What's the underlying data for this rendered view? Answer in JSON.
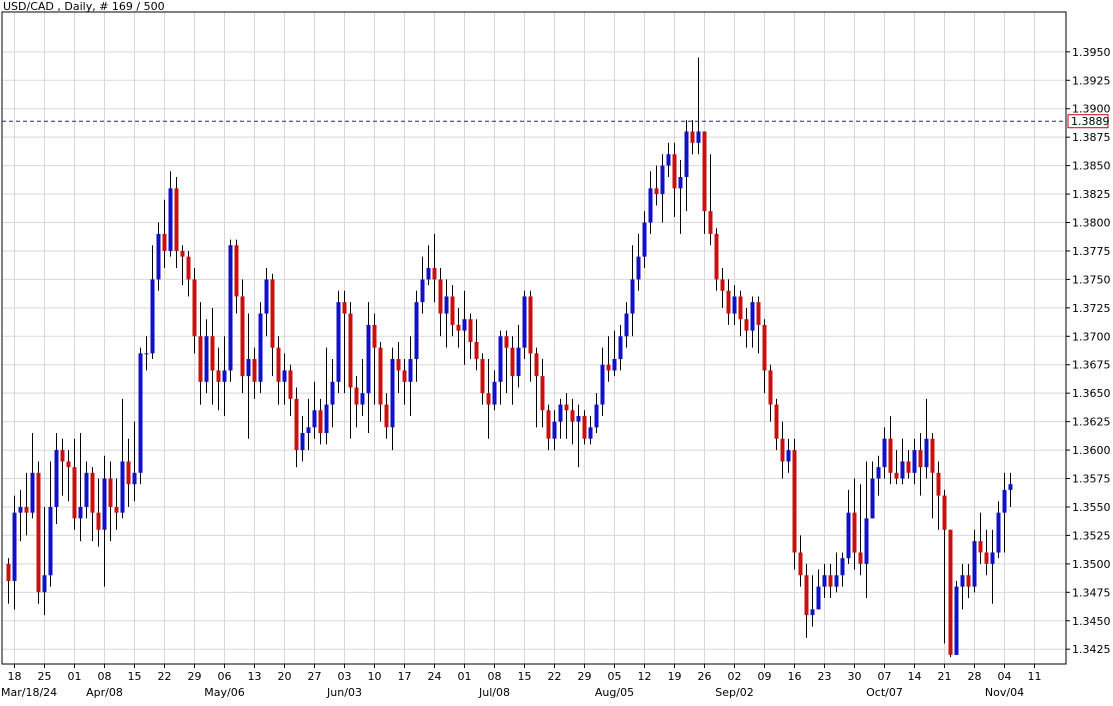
{
  "colors": {
    "up": "#1010c8",
    "down": "#c81010",
    "grid": "#d8d8d8",
    "last_line": "#2020a0",
    "last_box_border": "#d00000",
    "wick": "#000000"
  },
  "chart_data": {
    "type": "candlestick",
    "title": "USD/CAD , Daily, # 169 / 500",
    "last_price": "1.3889",
    "ylim": [
      1.3412,
      1.3985
    ],
    "y_ticks": [
      1.3425,
      1.345,
      1.3475,
      1.35,
      1.3525,
      1.355,
      1.3575,
      1.36,
      1.3625,
      1.365,
      1.3675,
      1.37,
      1.3725,
      1.375,
      1.3775,
      1.38,
      1.3825,
      1.385,
      1.3875,
      1.39,
      1.3925,
      1.395
    ],
    "y_tick_labels": [
      "1.3425",
      "1.3450",
      "1.3475",
      "1.3500",
      "1.3525",
      "1.3550",
      "1.3575",
      "1.3600",
      "1.3625",
      "1.3650",
      "1.3675",
      "1.3700",
      "1.3725",
      "1.3750",
      "1.3775",
      "1.3800",
      "1.3825",
      "1.3850",
      "1.3875",
      "1.3900",
      "1.3925",
      "1.3950"
    ],
    "x_tick_labels": [
      {
        "label": "18",
        "i": 1
      },
      {
        "label": "25",
        "i": 6
      },
      {
        "label": "01",
        "i": 11
      },
      {
        "label": "08",
        "i": 16
      },
      {
        "label": "15",
        "i": 21
      },
      {
        "label": "22",
        "i": 26
      },
      {
        "label": "29",
        "i": 31
      },
      {
        "label": "06",
        "i": 36
      },
      {
        "label": "13",
        "i": 41
      },
      {
        "label": "20",
        "i": 46
      },
      {
        "label": "27",
        "i": 51
      },
      {
        "label": "03",
        "i": 56
      },
      {
        "label": "10",
        "i": 61
      },
      {
        "label": "17",
        "i": 66
      },
      {
        "label": "24",
        "i": 71
      },
      {
        "label": "01",
        "i": 76
      },
      {
        "label": "08",
        "i": 81
      },
      {
        "label": "15",
        "i": 86
      },
      {
        "label": "22",
        "i": 91
      },
      {
        "label": "29",
        "i": 96
      },
      {
        "label": "05",
        "i": 101
      },
      {
        "label": "12",
        "i": 106
      },
      {
        "label": "19",
        "i": 111
      },
      {
        "label": "26",
        "i": 116
      },
      {
        "label": "02",
        "i": 121
      },
      {
        "label": "09",
        "i": 126
      },
      {
        "label": "16",
        "i": 131
      },
      {
        "label": "23",
        "i": 136
      },
      {
        "label": "30",
        "i": 141
      },
      {
        "label": "07",
        "i": 146
      },
      {
        "label": "14",
        "i": 151
      },
      {
        "label": "21",
        "i": 156
      },
      {
        "label": "28",
        "i": 161
      },
      {
        "label": "04",
        "i": 166
      },
      {
        "label": "11",
        "i": 171
      }
    ],
    "x_month_labels": [
      {
        "label": "Mar/18/24",
        "i": 1
      },
      {
        "label": "Apr/08",
        "i": 16
      },
      {
        "label": "May/06",
        "i": 36
      },
      {
        "label": "Jun/03",
        "i": 56
      },
      {
        "label": "Jul/08",
        "i": 81
      },
      {
        "label": "Aug/05",
        "i": 101
      },
      {
        "label": "Sep/02",
        "i": 121
      },
      {
        "label": "Oct/07",
        "i": 146
      },
      {
        "label": "Nov/04",
        "i": 166
      }
    ],
    "candles": [
      [
        1.35,
        1.3485,
        1.3505,
        1.3465
      ],
      [
        1.3485,
        1.3545,
        1.356,
        1.346
      ],
      [
        1.3545,
        1.355,
        1.3565,
        1.352
      ],
      [
        1.355,
        1.3545,
        1.358,
        1.3525
      ],
      [
        1.3545,
        1.358,
        1.3615,
        1.354
      ],
      [
        1.358,
        1.3475,
        1.359,
        1.3465
      ],
      [
        1.3475,
        1.349,
        1.355,
        1.3455
      ],
      [
        1.349,
        1.355,
        1.359,
        1.348
      ],
      [
        1.355,
        1.36,
        1.3615,
        1.3535
      ],
      [
        1.36,
        1.359,
        1.361,
        1.356
      ],
      [
        1.359,
        1.3585,
        1.36,
        1.3555
      ],
      [
        1.3585,
        1.354,
        1.361,
        1.353
      ],
      [
        1.354,
        1.355,
        1.3615,
        1.352
      ],
      [
        1.355,
        1.358,
        1.359,
        1.354
      ],
      [
        1.358,
        1.3545,
        1.3585,
        1.352
      ],
      [
        1.3545,
        1.353,
        1.3575,
        1.3515
      ],
      [
        1.353,
        1.3575,
        1.3595,
        1.348
      ],
      [
        1.3575,
        1.355,
        1.359,
        1.352
      ],
      [
        1.355,
        1.3545,
        1.3575,
        1.353
      ],
      [
        1.3545,
        1.359,
        1.3645,
        1.354
      ],
      [
        1.359,
        1.357,
        1.361,
        1.355
      ],
      [
        1.357,
        1.358,
        1.3625,
        1.3555
      ],
      [
        1.358,
        1.3685,
        1.369,
        1.357
      ],
      [
        1.3685,
        1.3685,
        1.37,
        1.367
      ],
      [
        1.3685,
        1.375,
        1.378,
        1.368
      ],
      [
        1.375,
        1.379,
        1.38,
        1.374
      ],
      [
        1.379,
        1.3775,
        1.382,
        1.376
      ],
      [
        1.3775,
        1.383,
        1.3845,
        1.377
      ],
      [
        1.383,
        1.3775,
        1.384,
        1.376
      ],
      [
        1.3775,
        1.377,
        1.378,
        1.3745
      ],
      [
        1.377,
        1.375,
        1.3775,
        1.3735
      ],
      [
        1.375,
        1.37,
        1.376,
        1.3685
      ],
      [
        1.37,
        1.366,
        1.373,
        1.364
      ],
      [
        1.366,
        1.37,
        1.3715,
        1.365
      ],
      [
        1.37,
        1.367,
        1.3725,
        1.364
      ],
      [
        1.367,
        1.366,
        1.369,
        1.3635
      ],
      [
        1.366,
        1.367,
        1.37,
        1.363
      ],
      [
        1.367,
        1.378,
        1.3785,
        1.366
      ],
      [
        1.378,
        1.3735,
        1.3785,
        1.372
      ],
      [
        1.3735,
        1.3665,
        1.375,
        1.365
      ],
      [
        1.3665,
        1.368,
        1.372,
        1.361
      ],
      [
        1.368,
        1.366,
        1.369,
        1.3645
      ],
      [
        1.366,
        1.372,
        1.373,
        1.365
      ],
      [
        1.372,
        1.375,
        1.376,
        1.37
      ],
      [
        1.375,
        1.369,
        1.3755,
        1.3665
      ],
      [
        1.369,
        1.366,
        1.37,
        1.364
      ],
      [
        1.366,
        1.367,
        1.3685,
        1.364
      ],
      [
        1.367,
        1.3645,
        1.3675,
        1.363
      ],
      [
        1.3645,
        1.36,
        1.3655,
        1.3585
      ],
      [
        1.36,
        1.3615,
        1.363,
        1.359
      ],
      [
        1.3615,
        1.362,
        1.3645,
        1.36
      ],
      [
        1.362,
        1.3635,
        1.366,
        1.361
      ],
      [
        1.3635,
        1.3615,
        1.3645,
        1.3605
      ],
      [
        1.3615,
        1.364,
        1.369,
        1.3605
      ],
      [
        1.364,
        1.366,
        1.368,
        1.362
      ],
      [
        1.366,
        1.373,
        1.374,
        1.365
      ],
      [
        1.373,
        1.372,
        1.374,
        1.365
      ],
      [
        1.372,
        1.3655,
        1.373,
        1.361
      ],
      [
        1.3655,
        1.364,
        1.3665,
        1.362
      ],
      [
        1.364,
        1.365,
        1.368,
        1.363
      ],
      [
        1.365,
        1.371,
        1.373,
        1.3615
      ],
      [
        1.371,
        1.369,
        1.372,
        1.364
      ],
      [
        1.369,
        1.364,
        1.3695,
        1.3625
      ],
      [
        1.364,
        1.362,
        1.365,
        1.361
      ],
      [
        1.362,
        1.368,
        1.369,
        1.36
      ],
      [
        1.368,
        1.367,
        1.3695,
        1.365
      ],
      [
        1.367,
        1.366,
        1.368,
        1.364
      ],
      [
        1.366,
        1.368,
        1.37,
        1.363
      ],
      [
        1.368,
        1.373,
        1.374,
        1.366
      ],
      [
        1.373,
        1.375,
        1.377,
        1.372
      ],
      [
        1.375,
        1.376,
        1.378,
        1.3745
      ],
      [
        1.376,
        1.375,
        1.379,
        1.373
      ],
      [
        1.375,
        1.372,
        1.376,
        1.37
      ],
      [
        1.372,
        1.3735,
        1.375,
        1.369
      ],
      [
        1.3735,
        1.371,
        1.3745,
        1.37
      ],
      [
        1.371,
        1.3705,
        1.3725,
        1.369
      ],
      [
        1.3705,
        1.3715,
        1.374,
        1.3675
      ],
      [
        1.3715,
        1.3695,
        1.372,
        1.368
      ],
      [
        1.3695,
        1.368,
        1.3715,
        1.367
      ],
      [
        1.368,
        1.365,
        1.3685,
        1.364
      ],
      [
        1.365,
        1.364,
        1.368,
        1.361
      ],
      [
        1.364,
        1.366,
        1.367,
        1.3635
      ],
      [
        1.366,
        1.37,
        1.3705,
        1.364
      ],
      [
        1.37,
        1.369,
        1.3705,
        1.365
      ],
      [
        1.369,
        1.3665,
        1.37,
        1.364
      ],
      [
        1.3665,
        1.369,
        1.371,
        1.3655
      ],
      [
        1.369,
        1.3735,
        1.374,
        1.368
      ],
      [
        1.3735,
        1.3685,
        1.374,
        1.366
      ],
      [
        1.3685,
        1.3665,
        1.369,
        1.362
      ],
      [
        1.3665,
        1.3635,
        1.368,
        1.362
      ],
      [
        1.3635,
        1.361,
        1.364,
        1.36
      ],
      [
        1.361,
        1.3625,
        1.3635,
        1.36
      ],
      [
        1.3625,
        1.364,
        1.3645,
        1.361
      ],
      [
        1.364,
        1.3635,
        1.365,
        1.361
      ],
      [
        1.3635,
        1.3625,
        1.3645,
        1.3605
      ],
      [
        1.3625,
        1.363,
        1.364,
        1.3585
      ],
      [
        1.363,
        1.361,
        1.3635,
        1.3605
      ],
      [
        1.361,
        1.362,
        1.363,
        1.3605
      ],
      [
        1.362,
        1.364,
        1.365,
        1.3615
      ],
      [
        1.364,
        1.3675,
        1.369,
        1.363
      ],
      [
        1.3675,
        1.367,
        1.37,
        1.366
      ],
      [
        1.367,
        1.368,
        1.3705,
        1.3665
      ],
      [
        1.368,
        1.37,
        1.371,
        1.367
      ],
      [
        1.37,
        1.372,
        1.373,
        1.369
      ],
      [
        1.372,
        1.375,
        1.378,
        1.37
      ],
      [
        1.375,
        1.377,
        1.379,
        1.374
      ],
      [
        1.377,
        1.38,
        1.381,
        1.376
      ],
      [
        1.38,
        1.383,
        1.3845,
        1.379
      ],
      [
        1.383,
        1.3825,
        1.385,
        1.3815
      ],
      [
        1.3825,
        1.385,
        1.386,
        1.38
      ],
      [
        1.385,
        1.386,
        1.387,
        1.384
      ],
      [
        1.386,
        1.383,
        1.387,
        1.3805
      ],
      [
        1.383,
        1.384,
        1.3855,
        1.379
      ],
      [
        1.384,
        1.388,
        1.389,
        1.381
      ],
      [
        1.388,
        1.387,
        1.389,
        1.386
      ],
      [
        1.387,
        1.388,
        1.3945,
        1.386
      ],
      [
        1.388,
        1.381,
        1.388,
        1.379
      ],
      [
        1.381,
        1.379,
        1.386,
        1.378
      ],
      [
        1.379,
        1.375,
        1.3795,
        1.374
      ],
      [
        1.375,
        1.374,
        1.376,
        1.3725
      ],
      [
        1.374,
        1.372,
        1.375,
        1.371
      ],
      [
        1.372,
        1.3735,
        1.3745,
        1.371
      ],
      [
        1.3735,
        1.3715,
        1.374,
        1.37
      ],
      [
        1.3715,
        1.3705,
        1.3725,
        1.369
      ],
      [
        1.3705,
        1.373,
        1.3735,
        1.369
      ],
      [
        1.373,
        1.371,
        1.3735,
        1.3685
      ],
      [
        1.371,
        1.367,
        1.3715,
        1.365
      ],
      [
        1.367,
        1.364,
        1.3675,
        1.3625
      ],
      [
        1.364,
        1.361,
        1.3645,
        1.36
      ],
      [
        1.361,
        1.359,
        1.3625,
        1.3575
      ],
      [
        1.359,
        1.36,
        1.361,
        1.358
      ],
      [
        1.36,
        1.351,
        1.361,
        1.3495
      ],
      [
        1.351,
        1.349,
        1.3525,
        1.348
      ],
      [
        1.349,
        1.3455,
        1.35,
        1.3435
      ],
      [
        1.3455,
        1.346,
        1.349,
        1.3445
      ],
      [
        1.346,
        1.348,
        1.3495,
        1.346
      ],
      [
        1.348,
        1.349,
        1.35,
        1.347
      ],
      [
        1.349,
        1.348,
        1.35,
        1.347
      ],
      [
        1.348,
        1.349,
        1.351,
        1.3475
      ],
      [
        1.349,
        1.3505,
        1.351,
        1.348
      ],
      [
        1.3505,
        1.3545,
        1.3565,
        1.35
      ],
      [
        1.3545,
        1.351,
        1.3575,
        1.3495
      ],
      [
        1.351,
        1.35,
        1.357,
        1.349
      ],
      [
        1.35,
        1.354,
        1.359,
        1.347
      ],
      [
        1.354,
        1.3575,
        1.359,
        1.354
      ],
      [
        1.3575,
        1.3585,
        1.3595,
        1.356
      ],
      [
        1.3585,
        1.361,
        1.362,
        1.3575
      ],
      [
        1.361,
        1.358,
        1.363,
        1.357
      ],
      [
        1.358,
        1.3575,
        1.36,
        1.357
      ],
      [
        1.3575,
        1.359,
        1.361,
        1.357
      ],
      [
        1.359,
        1.358,
        1.36,
        1.3575
      ],
      [
        1.358,
        1.36,
        1.361,
        1.357
      ],
      [
        1.36,
        1.3585,
        1.3615,
        1.356
      ],
      [
        1.3585,
        1.361,
        1.3645,
        1.3575
      ],
      [
        1.361,
        1.358,
        1.3615,
        1.354
      ],
      [
        1.358,
        1.356,
        1.359,
        1.353
      ],
      [
        1.356,
        1.353,
        1.3565,
        1.343
      ],
      [
        1.353,
        1.342,
        1.353,
        1.3418
      ],
      [
        1.342,
        1.348,
        1.3485,
        1.342
      ],
      [
        1.348,
        1.349,
        1.35,
        1.346
      ],
      [
        1.349,
        1.348,
        1.35,
        1.347
      ],
      [
        1.348,
        1.352,
        1.353,
        1.3475
      ],
      [
        1.352,
        1.351,
        1.3545,
        1.35
      ],
      [
        1.351,
        1.35,
        1.353,
        1.349
      ],
      [
        1.35,
        1.351,
        1.353,
        1.3465
      ],
      [
        1.351,
        1.3545,
        1.3555,
        1.3505
      ],
      [
        1.3545,
        1.3565,
        1.358,
        1.351
      ],
      [
        1.3565,
        1.357,
        1.358,
        1.355
      ]
    ]
  }
}
